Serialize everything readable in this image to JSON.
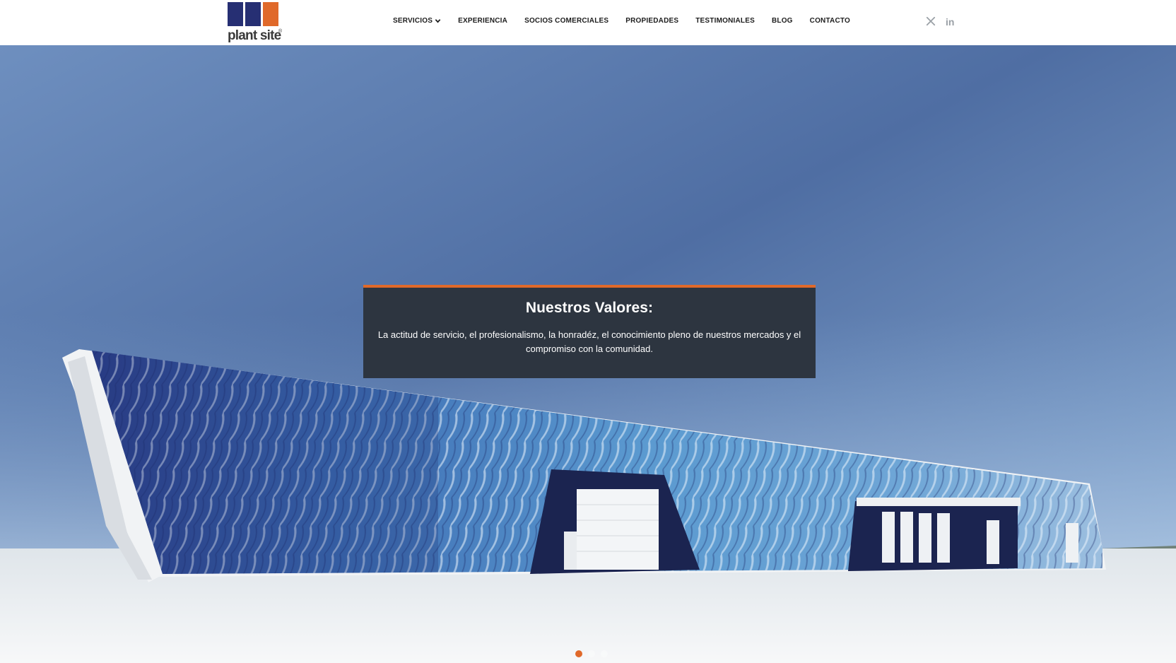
{
  "brand": {
    "name": "plant site",
    "registered": "®",
    "logo_colors": [
      "#262f73",
      "#262f73",
      "#e0692a"
    ]
  },
  "nav": {
    "items": [
      {
        "label": "SERVICIOS",
        "has_dropdown": true
      },
      {
        "label": "EXPERIENCIA"
      },
      {
        "label": "SOCIOS COMERCIALES"
      },
      {
        "label": "PROPIEDADES"
      },
      {
        "label": "TESTIMONIALES"
      },
      {
        "label": "BLOG"
      },
      {
        "label": "CONTACTO"
      }
    ]
  },
  "social": {
    "x_icon": "x-twitter-icon",
    "linkedin_icon": "linkedin-icon",
    "linkedin_glyph": "in"
  },
  "hero": {
    "title": "Nuestros Valores:",
    "text": "La actitud de servicio, el profesionalismo, la honradéz, el conocimiento pleno de nuestros mercados y el compromiso con la comunidad.",
    "slides": 3,
    "active_slide": 1
  },
  "colors": {
    "accent": "#e0692a",
    "box_bg": "#2d3540",
    "brand_blue": "#262f73",
    "text_dark": "#1d1d1d",
    "icon_gray": "#9aa0a6"
  }
}
